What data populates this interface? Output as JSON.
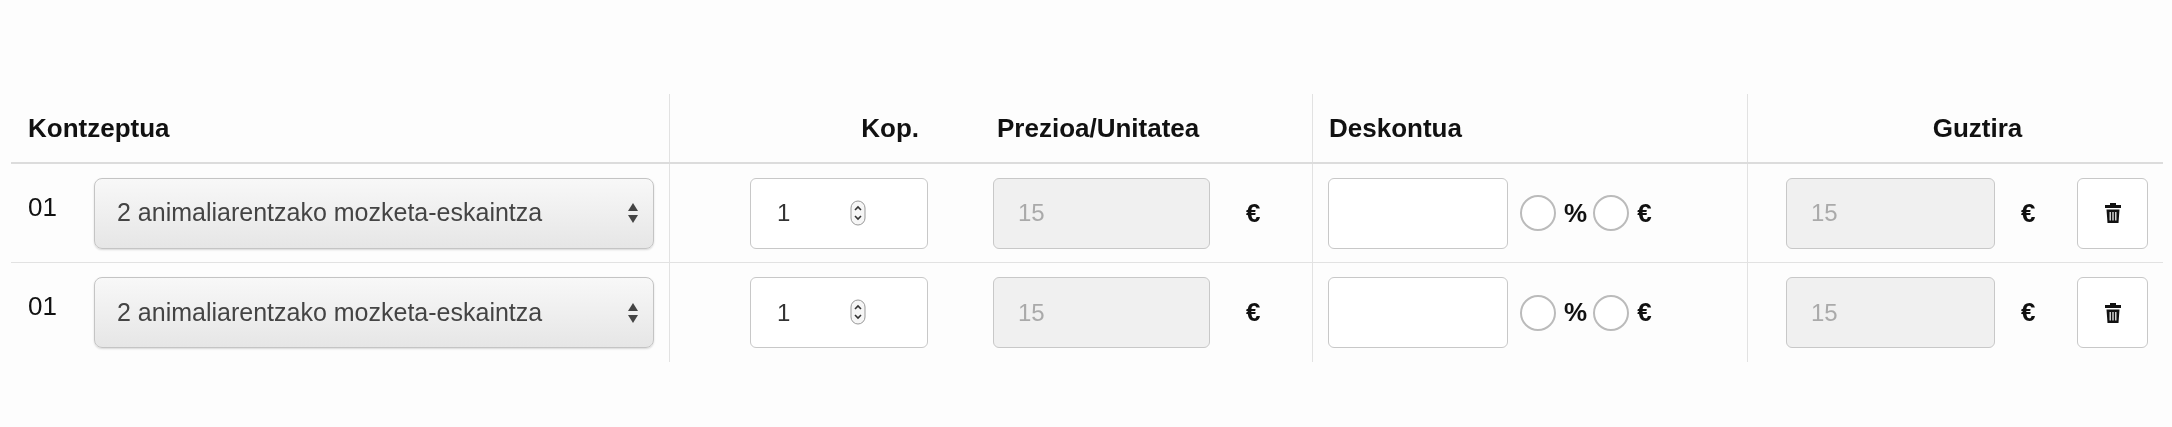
{
  "table": {
    "columns": [
      "Kontzeptua",
      "Kop.",
      "Prezioa/Unitatea",
      "Deskontua",
      "Guztira"
    ],
    "rows": [
      {
        "number": "01",
        "concept": "2 animaliarentzako mozketa-eskaintza",
        "quantity": "1",
        "price": {
          "value": "15",
          "disabled": true
        },
        "price_currency": "€",
        "discount_options": [
          {
            "label": "%",
            "selected": false
          },
          {
            "label": "€",
            "selected": false
          }
        ],
        "total": {
          "value": "15",
          "disabled": true
        },
        "total_currency": "€"
      },
      {
        "number": "01",
        "concept": "2 animaliarentzako mozketa-eskaintza",
        "quantity": "1",
        "price": {
          "value": "15",
          "disabled": true
        },
        "price_currency": "€",
        "discount_options": [
          {
            "label": "%",
            "selected": false
          },
          {
            "label": "€",
            "selected": false
          }
        ],
        "total": {
          "value": "15",
          "disabled": true
        },
        "total_currency": "€"
      }
    ]
  }
}
